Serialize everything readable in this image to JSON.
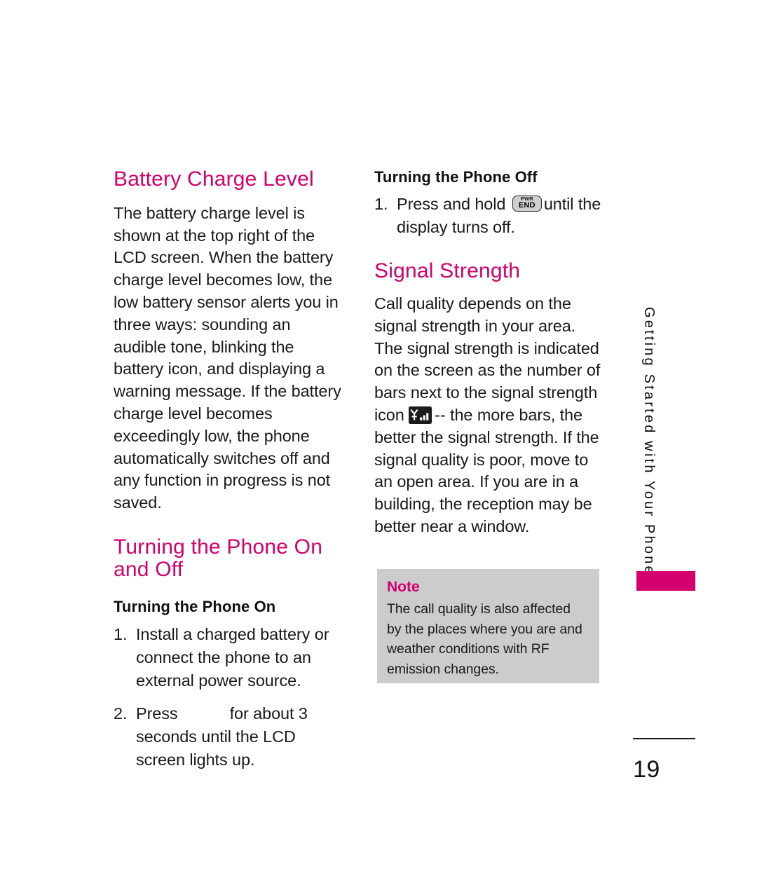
{
  "left_column": {
    "heading_battery": "Battery Charge Level",
    "battery_paragraph": "The battery charge level is shown at the top right of the LCD screen. When the battery charge level becomes low, the low battery sensor alerts you in three ways: sounding an audible tone, blinking the battery icon, and displaying a warning message. If the battery charge level becomes exceedingly low, the phone automatically switches off and any function in progress is not saved.",
    "heading_turning_on_off": "Turning the Phone On and Off",
    "subheading_turning_on": "Turning the Phone On",
    "steps_on": [
      {
        "number": "1.",
        "text": "Install a charged battery or connect the phone to an external power source."
      },
      {
        "number": "2.",
        "text_before": "Press",
        "key_icon": "power-key-icon",
        "text_after": "for about 3 seconds until the LCD screen lights up."
      }
    ]
  },
  "right_column": {
    "subheading_turning_off": "Turning the Phone Off",
    "steps_off": [
      {
        "number": "1.",
        "text_before": "Press and hold",
        "key_icon": "pwr-end-key-icon",
        "key_label_top": "PWR",
        "key_label_bottom": "END",
        "text_after": "until the display turns off."
      }
    ],
    "heading_signal": "Signal Strength",
    "signal_paragraph_before": "Call quality depends on the signal strength in your area. The signal strength is indicated on the screen as the number of bars next to the signal strength icon",
    "signal_icon": "signal-bars-icon",
    "signal_paragraph_after": "-- the more bars, the better the signal strength. If the signal quality is poor, move to an open area. If you are in a building, the reception may be better near a window.",
    "note": {
      "title": "Note",
      "text": "The call quality is also affected by the places where you are and weather conditions with RF emission changes."
    }
  },
  "side_tab": {
    "label": "Getting Started with Your Phone"
  },
  "footer": {
    "page_number": "19"
  },
  "colors": {
    "accent_pink": "#d4006e",
    "note_background": "#cccccc",
    "body_text": "#1a1a1a"
  }
}
